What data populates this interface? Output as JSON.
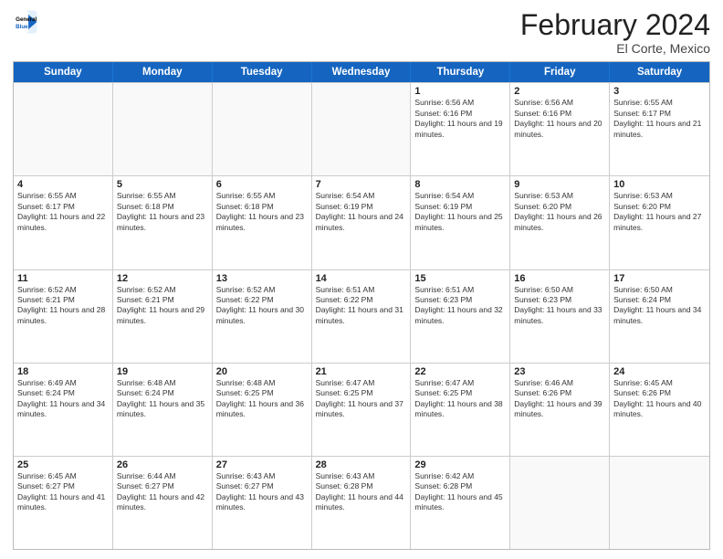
{
  "logo": {
    "line1": "General",
    "line2": "Blue"
  },
  "title": "February 2024",
  "subtitle": "El Corte, Mexico",
  "days_of_week": [
    "Sunday",
    "Monday",
    "Tuesday",
    "Wednesday",
    "Thursday",
    "Friday",
    "Saturday"
  ],
  "weeks": [
    [
      {
        "day": "",
        "info": ""
      },
      {
        "day": "",
        "info": ""
      },
      {
        "day": "",
        "info": ""
      },
      {
        "day": "",
        "info": ""
      },
      {
        "day": "1",
        "info": "Sunrise: 6:56 AM\nSunset: 6:16 PM\nDaylight: 11 hours and 19 minutes."
      },
      {
        "day": "2",
        "info": "Sunrise: 6:56 AM\nSunset: 6:16 PM\nDaylight: 11 hours and 20 minutes."
      },
      {
        "day": "3",
        "info": "Sunrise: 6:55 AM\nSunset: 6:17 PM\nDaylight: 11 hours and 21 minutes."
      }
    ],
    [
      {
        "day": "4",
        "info": "Sunrise: 6:55 AM\nSunset: 6:17 PM\nDaylight: 11 hours and 22 minutes."
      },
      {
        "day": "5",
        "info": "Sunrise: 6:55 AM\nSunset: 6:18 PM\nDaylight: 11 hours and 23 minutes."
      },
      {
        "day": "6",
        "info": "Sunrise: 6:55 AM\nSunset: 6:18 PM\nDaylight: 11 hours and 23 minutes."
      },
      {
        "day": "7",
        "info": "Sunrise: 6:54 AM\nSunset: 6:19 PM\nDaylight: 11 hours and 24 minutes."
      },
      {
        "day": "8",
        "info": "Sunrise: 6:54 AM\nSunset: 6:19 PM\nDaylight: 11 hours and 25 minutes."
      },
      {
        "day": "9",
        "info": "Sunrise: 6:53 AM\nSunset: 6:20 PM\nDaylight: 11 hours and 26 minutes."
      },
      {
        "day": "10",
        "info": "Sunrise: 6:53 AM\nSunset: 6:20 PM\nDaylight: 11 hours and 27 minutes."
      }
    ],
    [
      {
        "day": "11",
        "info": "Sunrise: 6:52 AM\nSunset: 6:21 PM\nDaylight: 11 hours and 28 minutes."
      },
      {
        "day": "12",
        "info": "Sunrise: 6:52 AM\nSunset: 6:21 PM\nDaylight: 11 hours and 29 minutes."
      },
      {
        "day": "13",
        "info": "Sunrise: 6:52 AM\nSunset: 6:22 PM\nDaylight: 11 hours and 30 minutes."
      },
      {
        "day": "14",
        "info": "Sunrise: 6:51 AM\nSunset: 6:22 PM\nDaylight: 11 hours and 31 minutes."
      },
      {
        "day": "15",
        "info": "Sunrise: 6:51 AM\nSunset: 6:23 PM\nDaylight: 11 hours and 32 minutes."
      },
      {
        "day": "16",
        "info": "Sunrise: 6:50 AM\nSunset: 6:23 PM\nDaylight: 11 hours and 33 minutes."
      },
      {
        "day": "17",
        "info": "Sunrise: 6:50 AM\nSunset: 6:24 PM\nDaylight: 11 hours and 34 minutes."
      }
    ],
    [
      {
        "day": "18",
        "info": "Sunrise: 6:49 AM\nSunset: 6:24 PM\nDaylight: 11 hours and 34 minutes."
      },
      {
        "day": "19",
        "info": "Sunrise: 6:48 AM\nSunset: 6:24 PM\nDaylight: 11 hours and 35 minutes."
      },
      {
        "day": "20",
        "info": "Sunrise: 6:48 AM\nSunset: 6:25 PM\nDaylight: 11 hours and 36 minutes."
      },
      {
        "day": "21",
        "info": "Sunrise: 6:47 AM\nSunset: 6:25 PM\nDaylight: 11 hours and 37 minutes."
      },
      {
        "day": "22",
        "info": "Sunrise: 6:47 AM\nSunset: 6:25 PM\nDaylight: 11 hours and 38 minutes."
      },
      {
        "day": "23",
        "info": "Sunrise: 6:46 AM\nSunset: 6:26 PM\nDaylight: 11 hours and 39 minutes."
      },
      {
        "day": "24",
        "info": "Sunrise: 6:45 AM\nSunset: 6:26 PM\nDaylight: 11 hours and 40 minutes."
      }
    ],
    [
      {
        "day": "25",
        "info": "Sunrise: 6:45 AM\nSunset: 6:27 PM\nDaylight: 11 hours and 41 minutes."
      },
      {
        "day": "26",
        "info": "Sunrise: 6:44 AM\nSunset: 6:27 PM\nDaylight: 11 hours and 42 minutes."
      },
      {
        "day": "27",
        "info": "Sunrise: 6:43 AM\nSunset: 6:27 PM\nDaylight: 11 hours and 43 minutes."
      },
      {
        "day": "28",
        "info": "Sunrise: 6:43 AM\nSunset: 6:28 PM\nDaylight: 11 hours and 44 minutes."
      },
      {
        "day": "29",
        "info": "Sunrise: 6:42 AM\nSunset: 6:28 PM\nDaylight: 11 hours and 45 minutes."
      },
      {
        "day": "",
        "info": ""
      },
      {
        "day": "",
        "info": ""
      }
    ]
  ]
}
